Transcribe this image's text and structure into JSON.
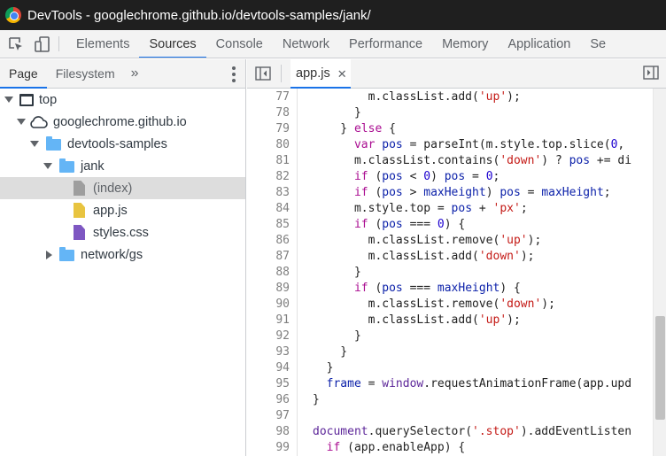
{
  "window": {
    "title": "DevTools - googlechrome.github.io/devtools-samples/jank/"
  },
  "toolbar": {
    "inspect_icon": "inspect-element-icon",
    "device_icon": "device-toolbar-icon",
    "tabs": [
      {
        "label": "Elements",
        "active": false
      },
      {
        "label": "Sources",
        "active": true
      },
      {
        "label": "Console",
        "active": false
      },
      {
        "label": "Network",
        "active": false
      },
      {
        "label": "Performance",
        "active": false
      },
      {
        "label": "Memory",
        "active": false
      },
      {
        "label": "Application",
        "active": false
      },
      {
        "label": "Se",
        "active": false
      }
    ]
  },
  "navigator": {
    "tabs": [
      {
        "label": "Page",
        "active": true
      },
      {
        "label": "Filesystem",
        "active": false
      }
    ],
    "more_label": "»",
    "tree": [
      {
        "label": "top",
        "icon": "frame-icon",
        "depth": 0,
        "expanded": true
      },
      {
        "label": "googlechrome.github.io",
        "icon": "cloud-icon",
        "depth": 1,
        "expanded": true
      },
      {
        "label": "devtools-samples",
        "icon": "folder-icon",
        "depth": 2,
        "expanded": true
      },
      {
        "label": "jank",
        "icon": "folder-icon",
        "depth": 3,
        "expanded": true
      },
      {
        "label": "(index)",
        "icon": "document-icon",
        "depth": 4,
        "selected": true
      },
      {
        "label": "app.js",
        "icon": "script-icon",
        "depth": 4
      },
      {
        "label": "styles.css",
        "icon": "stylesheet-icon",
        "depth": 4
      },
      {
        "label": "network/gs",
        "icon": "folder-icon",
        "depth": 3,
        "expanded": false
      }
    ]
  },
  "editor": {
    "open_tab": {
      "label": "app.js",
      "close_label": "✕"
    },
    "lines": [
      {
        "n": "77",
        "code": "        m.classList.add('up');"
      },
      {
        "n": "78",
        "code": "      }"
      },
      {
        "n": "79",
        "code": "    } else {"
      },
      {
        "n": "80",
        "code": "      var pos = parseInt(m.style.top.slice(0,"
      },
      {
        "n": "81",
        "code": "      m.classList.contains('down') ? pos += di"
      },
      {
        "n": "82",
        "code": "      if (pos < 0) pos = 0;"
      },
      {
        "n": "83",
        "code": "      if (pos > maxHeight) pos = maxHeight;"
      },
      {
        "n": "84",
        "code": "      m.style.top = pos + 'px';"
      },
      {
        "n": "85",
        "code": "      if (pos === 0) {"
      },
      {
        "n": "86",
        "code": "        m.classList.remove('up');"
      },
      {
        "n": "87",
        "code": "        m.classList.add('down');"
      },
      {
        "n": "88",
        "code": "      }"
      },
      {
        "n": "89",
        "code": "      if (pos === maxHeight) {"
      },
      {
        "n": "90",
        "code": "        m.classList.remove('down');"
      },
      {
        "n": "91",
        "code": "        m.classList.add('up');"
      },
      {
        "n": "92",
        "code": "      }"
      },
      {
        "n": "93",
        "code": "    }"
      },
      {
        "n": "94",
        "code": "  }"
      },
      {
        "n": "95",
        "code": "  frame = window.requestAnimationFrame(app.upd"
      },
      {
        "n": "96",
        "code": "}"
      },
      {
        "n": "97",
        "code": ""
      },
      {
        "n": "98",
        "code": "document.querySelector('.stop').addEventListen"
      },
      {
        "n": "99",
        "code": "  if (app.enableApp) {"
      }
    ]
  },
  "colors": {
    "accent": "#1a73e8",
    "keyword": "#aa0d91",
    "string": "#c41a16",
    "number": "#1c00cf"
  }
}
